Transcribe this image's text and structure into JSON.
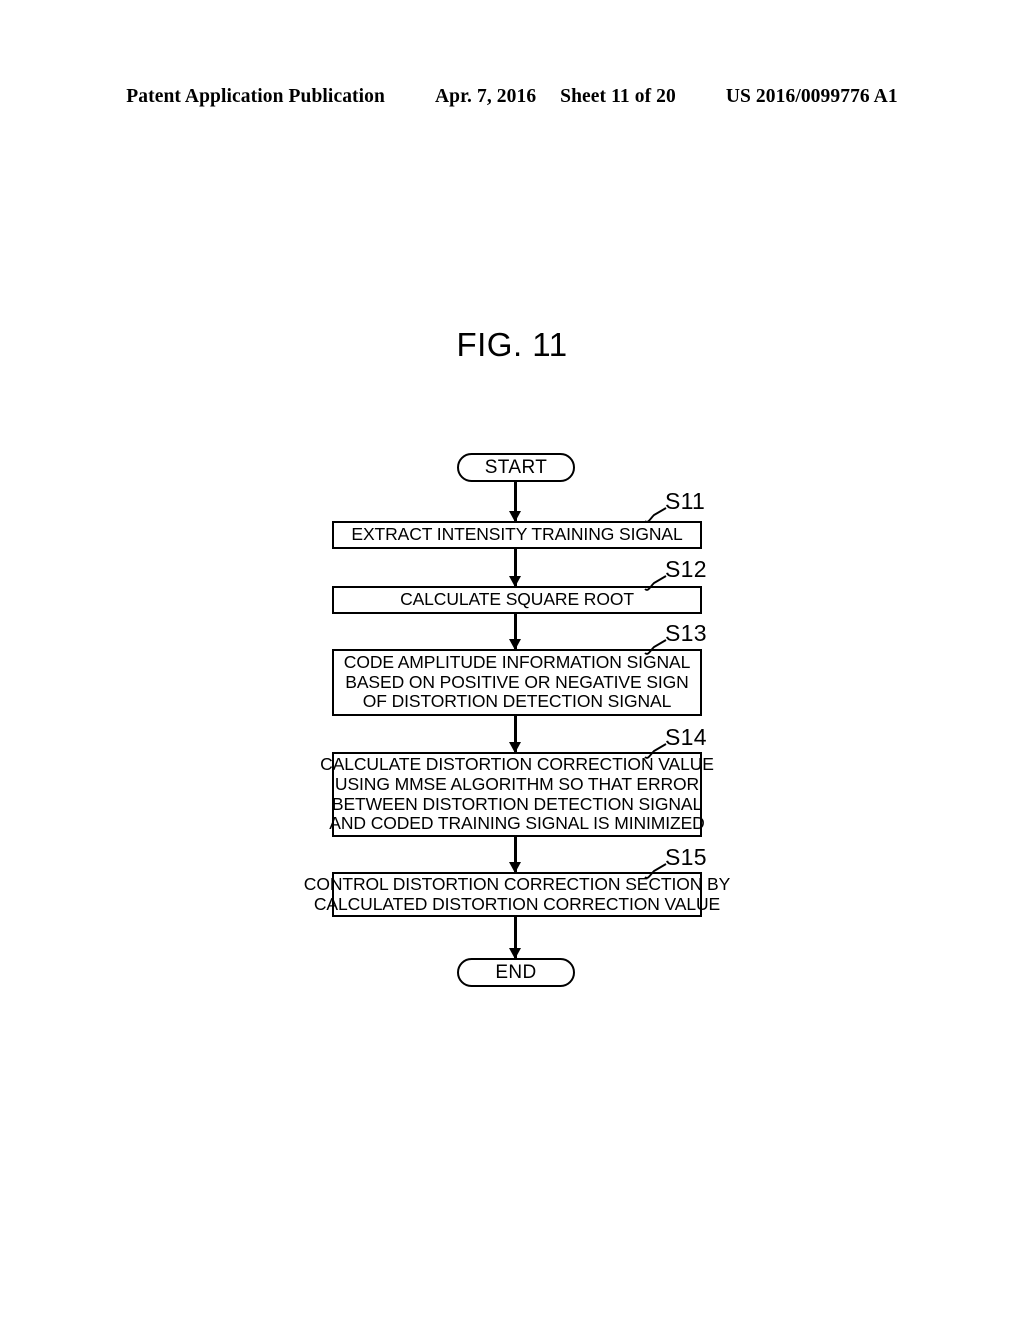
{
  "header": {
    "publication": "Patent Application Publication",
    "date": "Apr. 7, 2016",
    "sheet": "Sheet 11 of 20",
    "patent_number": "US 2016/0099776 A1"
  },
  "figure": {
    "title": "FIG. 11"
  },
  "flowchart": {
    "start_label": "START",
    "end_label": "END",
    "steps": [
      {
        "ref": "S11",
        "lines": [
          "EXTRACT INTENSITY TRAINING SIGNAL"
        ]
      },
      {
        "ref": "S12",
        "lines": [
          "CALCULATE SQUARE ROOT"
        ]
      },
      {
        "ref": "S13",
        "lines": [
          "CODE AMPLITUDE INFORMATION SIGNAL",
          "BASED ON POSITIVE OR NEGATIVE SIGN",
          "OF DISTORTION DETECTION SIGNAL"
        ]
      },
      {
        "ref": "S14",
        "lines": [
          "CALCULATE DISTORTION CORRECTION VALUE",
          "USING MMSE ALGORITHM SO THAT ERROR",
          "BETWEEN DISTORTION DETECTION SIGNAL",
          "AND CODED TRAINING SIGNAL IS MINIMIZED"
        ]
      },
      {
        "ref": "S15",
        "lines": [
          "CONTROL DISTORTION CORRECTION SECTION BY",
          "CALCULATED DISTORTION CORRECTION VALUE"
        ]
      }
    ]
  },
  "colors": {
    "ink": "#000000",
    "paper": "#ffffff"
  }
}
